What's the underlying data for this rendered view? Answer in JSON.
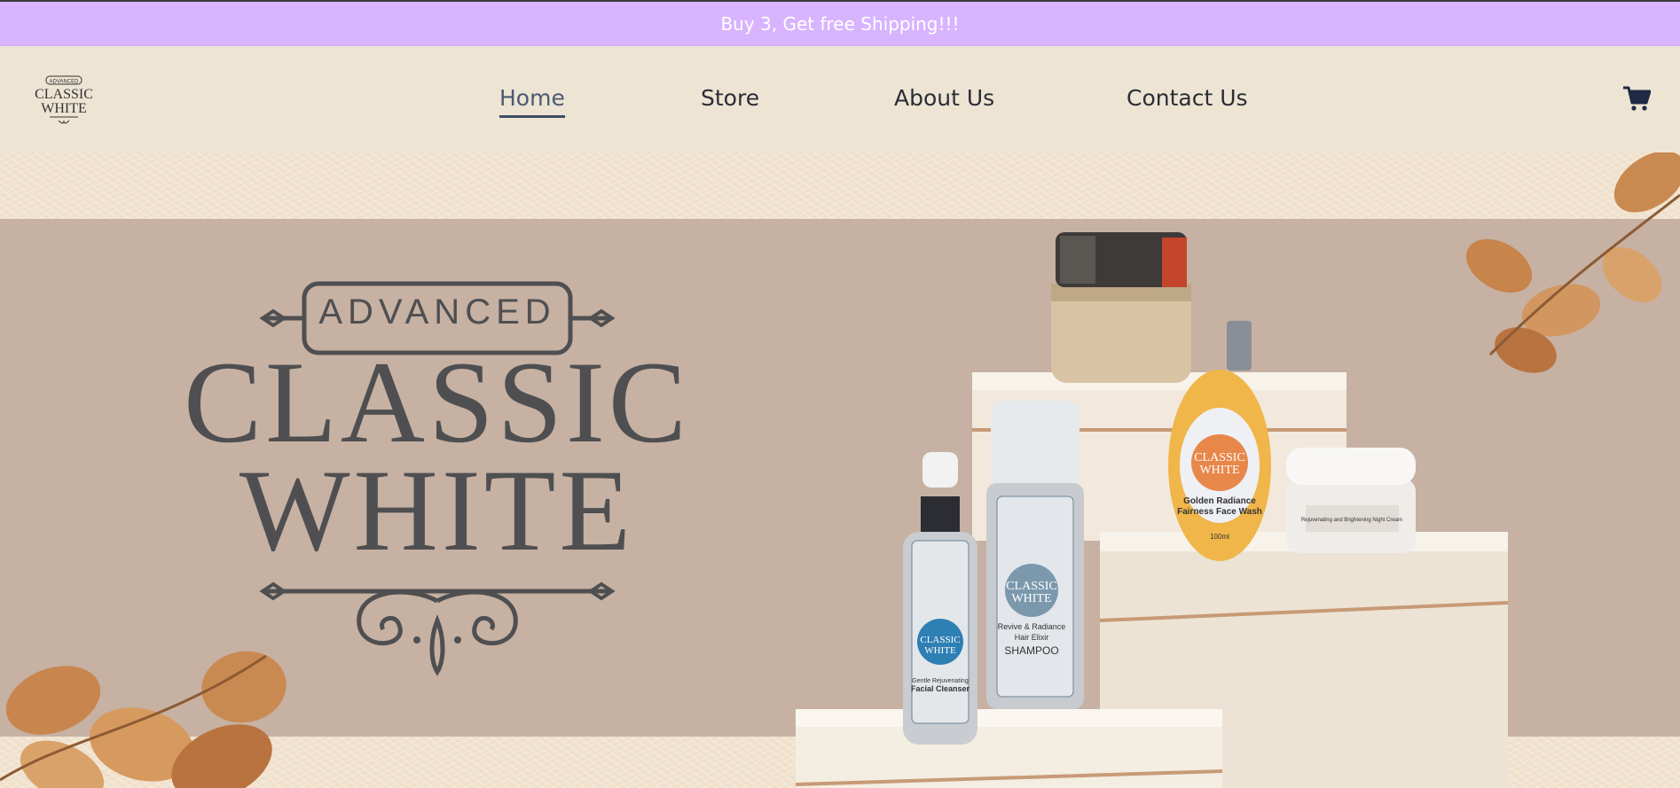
{
  "promo": {
    "text": "Buy 3, Get free Shipping!!!"
  },
  "header": {
    "logo": {
      "line1": "ADVANCED",
      "line2": "CLASSIC",
      "line3": "WHITE"
    },
    "nav": [
      {
        "label": "Home",
        "active": true
      },
      {
        "label": "Store",
        "active": false
      },
      {
        "label": "About Us",
        "active": false
      },
      {
        "label": "Contact Us",
        "active": false
      }
    ],
    "cart_icon": "shopping-cart-icon"
  },
  "hero": {
    "brand_advanced": "ADVANCED",
    "brand_classic": "CLASSIC",
    "brand_white": "WHITE",
    "products": {
      "face_wash": {
        "brand1": "CLASSIC",
        "brand2": "WHITE",
        "name1": "Golden Radiance",
        "name2": "Fairness Face Wash",
        "size": "100ml"
      },
      "shampoo": {
        "brand1": "CLASSIC",
        "brand2": "WHITE",
        "name1": "Revive & Radiance",
        "name2": "Hair Elixir",
        "name3": "SHAMPOO"
      },
      "cleanser": {
        "brand1": "CLASSIC",
        "brand2": "WHITE",
        "name1": "Gentle Rejuvenating",
        "name2": "Facial Cleanser"
      },
      "night_cream": {
        "name": "Rejuvenating and Brightening Night Cream"
      }
    }
  },
  "colors": {
    "promo_bg": "#d8b4fe",
    "header_bg": "#ede4d3",
    "hero_band": "#c6b1a3",
    "brand_text": "#4f4f51"
  }
}
